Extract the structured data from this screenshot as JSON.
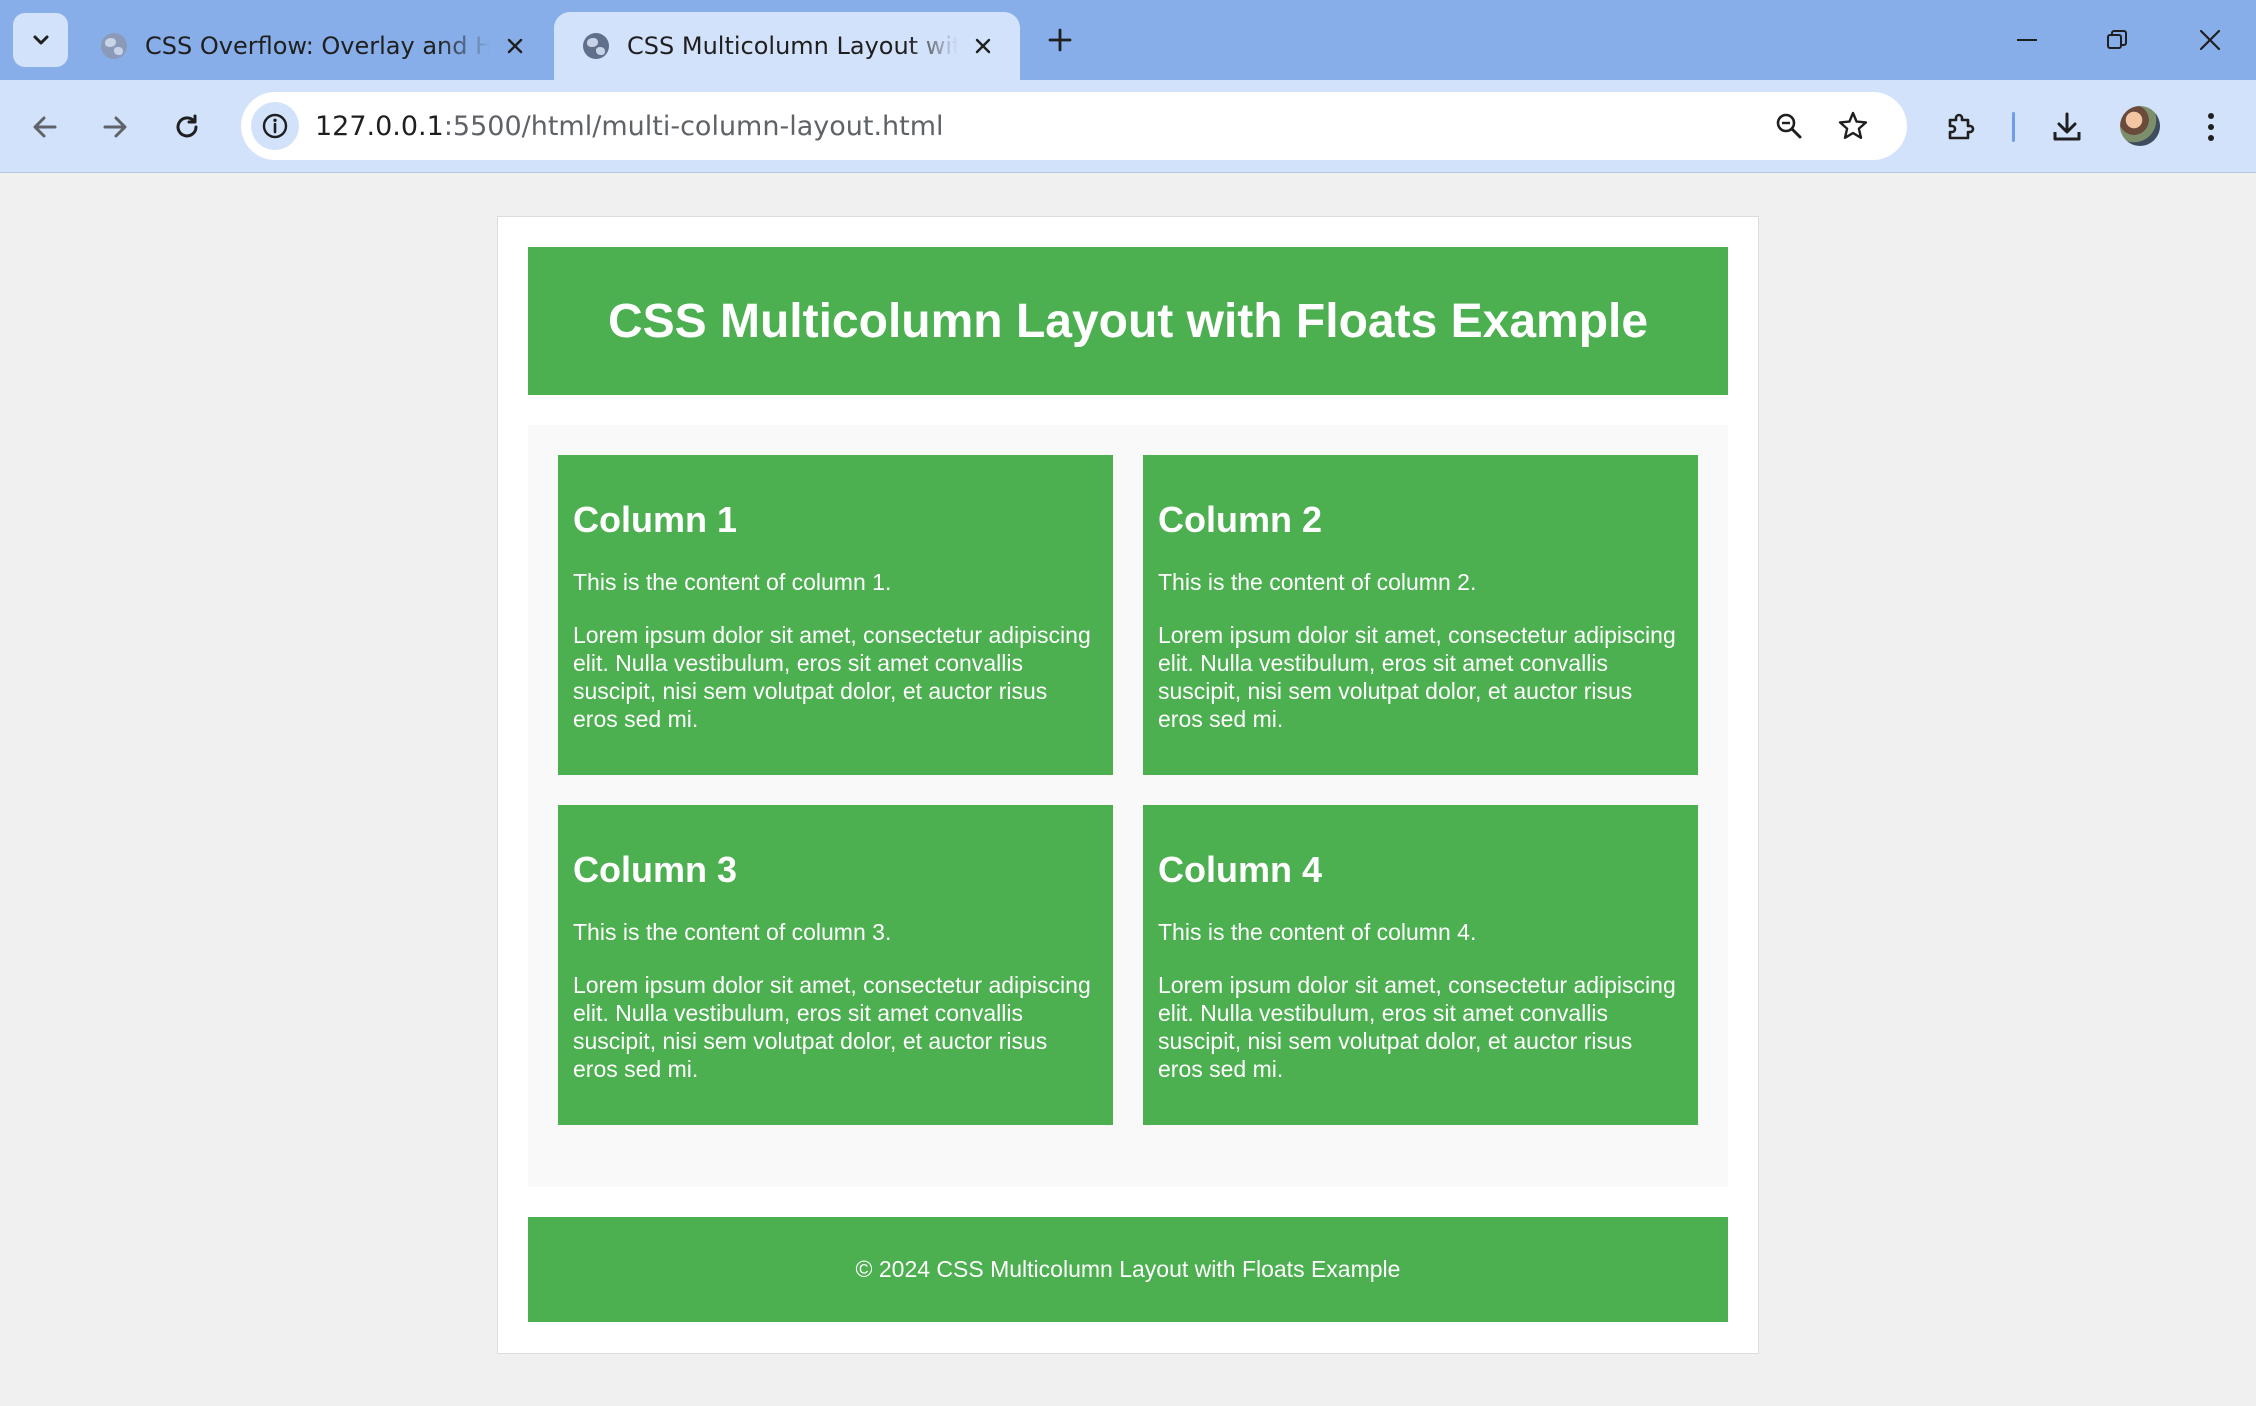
{
  "browser": {
    "tabs": [
      {
        "title": "CSS Overflow: Overlay and Hidden",
        "active": false
      },
      {
        "title": "CSS Multicolumn Layout with Floats Example",
        "active": true
      }
    ],
    "url": {
      "host": "127.0.0.1",
      "rest": ":5500/html/multi-column-layout.html"
    },
    "icons": {
      "tab_search": "chevron-down-icon",
      "new_tab": "plus-icon",
      "back": "arrow-left-icon",
      "forward": "arrow-right-icon",
      "reload": "reload-icon",
      "site_info": "info-icon",
      "zoom": "zoom-icon",
      "bookmark": "star-icon",
      "extensions": "puzzle-icon",
      "download": "download-icon",
      "menu": "kebab-menu-icon"
    },
    "accent_color": "#87aee8"
  },
  "page": {
    "header_title": "CSS Multicolumn Layout with Floats Example",
    "columns": [
      {
        "heading": "Column 1",
        "intro": "This is the content of column 1.",
        "lorem": "Lorem ipsum dolor sit amet, consectetur adipiscing elit. Nulla vestibulum, eros sit amet convallis suscipit, nisi sem volutpat dolor, et auctor risus eros sed mi."
      },
      {
        "heading": "Column 2",
        "intro": "This is the content of column 2.",
        "lorem": "Lorem ipsum dolor sit amet, consectetur adipiscing elit. Nulla vestibulum, eros sit amet convallis suscipit, nisi sem volutpat dolor, et auctor risus eros sed mi."
      },
      {
        "heading": "Column 3",
        "intro": "This is the content of column 3.",
        "lorem": "Lorem ipsum dolor sit amet, consectetur adipiscing elit. Nulla vestibulum, eros sit amet convallis suscipit, nisi sem volutpat dolor, et auctor risus eros sed mi."
      },
      {
        "heading": "Column 4",
        "intro": "This is the content of column 4.",
        "lorem": "Lorem ipsum dolor sit amet, consectetur adipiscing elit. Nulla vestibulum, eros sit amet convallis suscipit, nisi sem volutpat dolor, et auctor risus eros sed mi."
      }
    ],
    "footer_text": "© 2024 CSS Multicolumn Layout with Floats Example",
    "green": "#4caf50"
  }
}
